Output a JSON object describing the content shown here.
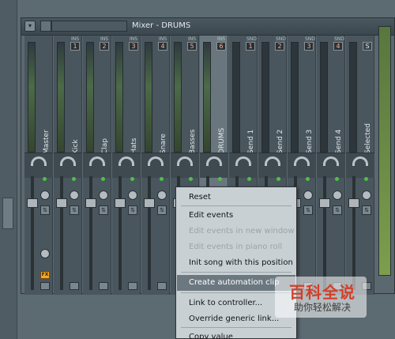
{
  "window": {
    "title": "Mixer - DRUMS"
  },
  "strips": [
    {
      "name": "Master",
      "badge_tag": "",
      "badge": "",
      "selected": false
    },
    {
      "name": "Kick",
      "badge_tag": "INS",
      "badge": "1",
      "selected": false
    },
    {
      "name": "Clap",
      "badge_tag": "INS",
      "badge": "2",
      "selected": false
    },
    {
      "name": "Hats",
      "badge_tag": "INS",
      "badge": "3",
      "selected": false
    },
    {
      "name": "Snare",
      "badge_tag": "INS",
      "badge": "4",
      "selected": false
    },
    {
      "name": "Basses",
      "badge_tag": "INS",
      "badge": "5",
      "selected": false
    },
    {
      "name": "DRUMS",
      "badge_tag": "INS",
      "badge": "6",
      "selected": true
    },
    {
      "name": "Send 1",
      "badge_tag": "SND",
      "badge": "1",
      "selected": false
    },
    {
      "name": "Send 2",
      "badge_tag": "SND",
      "badge": "2",
      "selected": false
    },
    {
      "name": "Send 3",
      "badge_tag": "SND",
      "badge": "3",
      "selected": false
    },
    {
      "name": "Send 4",
      "badge_tag": "SND",
      "badge": "4",
      "selected": false
    },
    {
      "name": "Selected",
      "badge_tag": "",
      "badge": "S",
      "selected": false
    }
  ],
  "fx_button_label": "FX",
  "context_menu": {
    "items": [
      {
        "label": "Reset",
        "disabled": false,
        "highlighted": false
      },
      {
        "label": "Edit events",
        "disabled": false,
        "highlighted": false
      },
      {
        "label": "Edit events in new window",
        "disabled": true,
        "highlighted": false
      },
      {
        "label": "Edit events in piano roll",
        "disabled": true,
        "highlighted": false
      },
      {
        "label": "Init song with this position",
        "disabled": false,
        "highlighted": false
      },
      {
        "label": "Create automation clip",
        "disabled": false,
        "highlighted": true
      },
      {
        "label": "Link to controller...",
        "disabled": false,
        "highlighted": false
      },
      {
        "label": "Override generic link...",
        "disabled": false,
        "highlighted": false
      },
      {
        "label": "Copy value",
        "disabled": false,
        "highlighted": false
      }
    ]
  },
  "watermark": {
    "title": "百科全说",
    "subtitle": "助你轻松解决"
  },
  "colors": {
    "accent": "#f5a623",
    "menu_highlight": "#6b7880",
    "led": "#4fc048"
  }
}
